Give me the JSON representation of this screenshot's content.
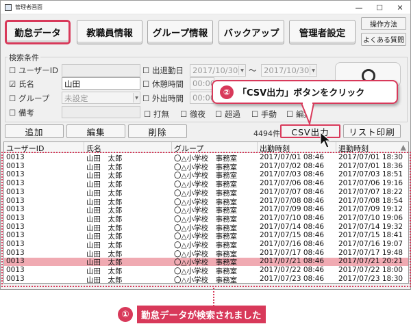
{
  "window": {
    "title": "管理者画面",
    "controls": [
      "—",
      "☐",
      "✕"
    ]
  },
  "top_buttons": [
    "勤怠データ",
    "教職員情報",
    "グループ情報",
    "バックアップ",
    "管理者設定"
  ],
  "side_buttons": {
    "manual": "操作方法",
    "faq": "よくある質問"
  },
  "search": {
    "group_label": "検索条件",
    "user_id_label": "ユーザーID",
    "name_label": "氏名",
    "name_value": "山田",
    "group_label2": "グループ",
    "group_value": "未設定",
    "note_label": "備考",
    "work_date_label": "出退勤日",
    "date_from": "2017/10/30",
    "date_sep": "～",
    "date_to": "2017/10/30",
    "break_label": "休憩時間",
    "break_value": "00:00",
    "out_label": "外出時間",
    "out_value": "00:00",
    "checks": [
      "打無",
      "徹夜",
      "超過",
      "手動",
      "編集"
    ]
  },
  "actions": {
    "add": "追加",
    "edit": "編集",
    "delete": "削除",
    "count": "4494件",
    "csv": "CSV出力",
    "print": "リスト印刷"
  },
  "table": {
    "headers": [
      "ユーザーID",
      "氏名",
      "グループ",
      "出勤時刻",
      "退勤時刻"
    ],
    "rows": [
      [
        "0013",
        "山田　太郎",
        "〇△小学校　事務室",
        "2017/07/01 08:46",
        "2017/07/01 18:30"
      ],
      [
        "0013",
        "山田　太郎",
        "〇△小学校　事務室",
        "2017/07/02 08:46",
        "2017/07/01 18:36"
      ],
      [
        "0013",
        "山田　太郎",
        "〇△小学校　事務室",
        "2017/07/03 08:46",
        "2017/07/03 18:51"
      ],
      [
        "0013",
        "山田　太郎",
        "〇△小学校　事務室",
        "2017/07/06 08:46",
        "2017/07/06 19:16"
      ],
      [
        "0013",
        "山田　太郎",
        "〇△小学校　事務室",
        "2017/07/07 08:46",
        "2017/07/07 18:22"
      ],
      [
        "0013",
        "山田　太郎",
        "〇△小学校　事務室",
        "2017/07/08 08:46",
        "2017/07/08 18:54"
      ],
      [
        "0013",
        "山田　太郎",
        "〇△小学校　事務室",
        "2017/07/09 08:46",
        "2017/07/09 19:12"
      ],
      [
        "0013",
        "山田　太郎",
        "〇△小学校　事務室",
        "2017/07/10 08:46",
        "2017/07/10 19:06"
      ],
      [
        "0013",
        "山田　太郎",
        "〇△小学校　事務室",
        "2017/07/14 08:46",
        "2017/07/14 19:32"
      ],
      [
        "0013",
        "山田　太郎",
        "〇△小学校　事務室",
        "2017/07/15 08:46",
        "2017/07/15 18:41"
      ],
      [
        "0013",
        "山田　太郎",
        "〇△小学校　事務室",
        "2017/07/16 08:46",
        "2017/07/16 19:07"
      ],
      [
        "0013",
        "山田　太郎",
        "〇△小学校　事務室",
        "2017/07/17 08:46",
        "2017/07/17 19:48"
      ],
      [
        "0013",
        "山田　太郎",
        "〇△小学校　事務室",
        "2017/07/21 08:46",
        "2017/07/21 20:21"
      ],
      [
        "0013",
        "山田　太郎",
        "〇△小学校　事務室",
        "2017/07/22 08:46",
        "2017/07/22 18:00"
      ],
      [
        "0013",
        "山田　太郎",
        "〇△小学校　事務室",
        "2017/07/23 08:46",
        "2017/07/23 18:30"
      ]
    ],
    "highlight_row": 12
  },
  "annotations": {
    "callout_num": "②",
    "callout_text": "「CSV出力」ボタンをクリック",
    "note_num": "①",
    "note_text": "勤怠データが検索されました"
  },
  "colors": {
    "accent": "#d8395a",
    "highlight_row": "#f0aab2"
  }
}
